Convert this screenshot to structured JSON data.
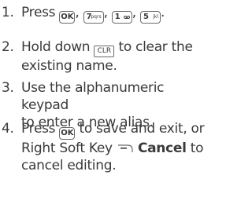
{
  "steps": [
    {
      "number": "1.",
      "text_a": "Press ",
      "keys": [
        {
          "label": "OK",
          "sub": ""
        },
        {
          "label": "7",
          "sub": "pqrs"
        },
        {
          "label": "1",
          "sub": "voicemail-icon"
        },
        {
          "label": "5",
          "sub": "jkl"
        }
      ],
      "key_2_sub": "pqrs",
      "key_4_sub": "jkl",
      "sep": ",",
      "end": "."
    },
    {
      "number": "2.",
      "line1_a": "Hold down ",
      "key": "CLR",
      "line1_b": " to clear the",
      "line2": "existing name."
    },
    {
      "number": "3.",
      "line1": "Use the alphanumeric keypad",
      "line2": "to enter a new alias."
    },
    {
      "number": "4.",
      "line1_a": "Press ",
      "key": "OK",
      "line1_b": " to save and exit, or",
      "line2_a": "Right Soft Key ",
      "line2_bold": "Cancel",
      "line2_b": " to",
      "line3": "cancel editing."
    }
  ],
  "colors": {
    "text": "#3a3a3a",
    "key_border": "#6a6a6a"
  }
}
